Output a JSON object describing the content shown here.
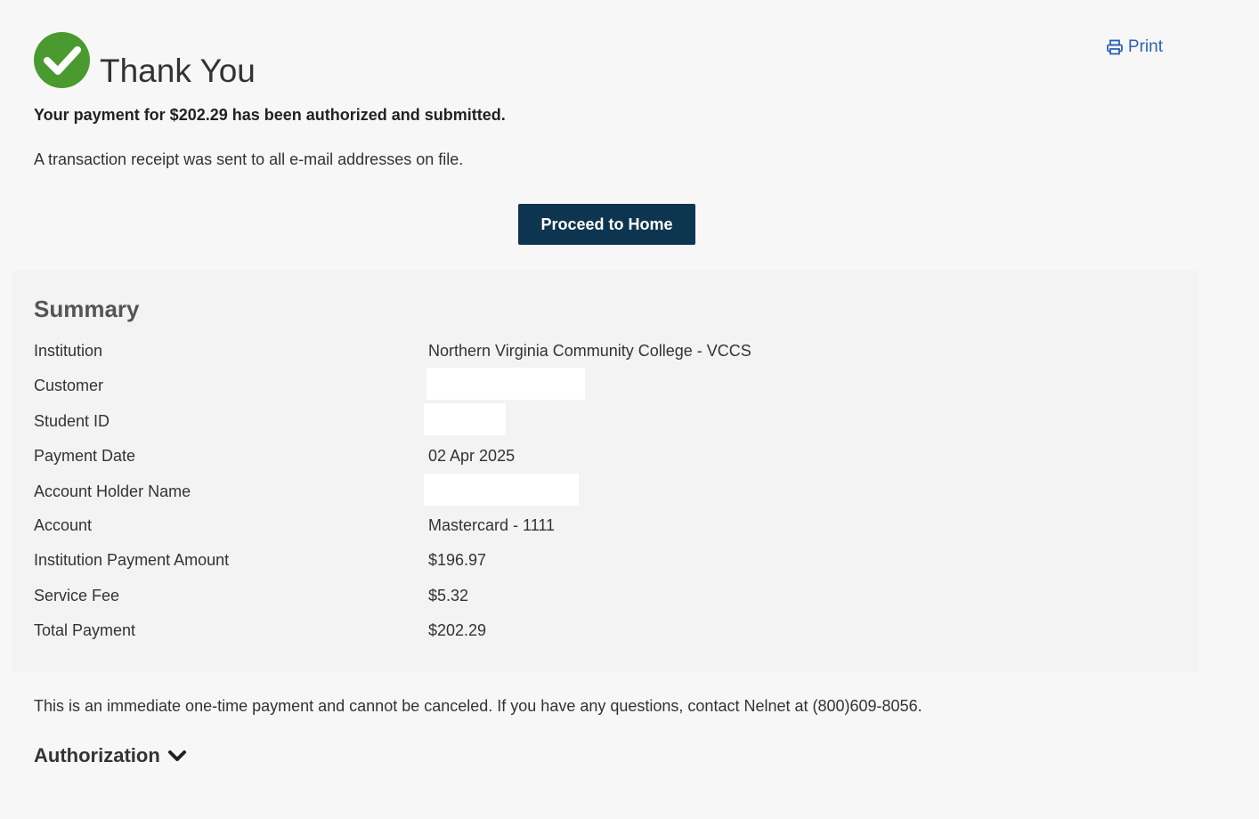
{
  "header": {
    "title": "Thank You",
    "print_label": "Print"
  },
  "messages": {
    "confirmation": "Your payment for $202.29 has been authorized and submitted.",
    "receipt": "A transaction receipt was sent to all e-mail addresses on file."
  },
  "actions": {
    "proceed_home_label": "Proceed to Home"
  },
  "summary": {
    "title": "Summary",
    "rows": [
      {
        "label": "Institution",
        "value": "Northern Virginia Community College - VCCS"
      },
      {
        "label": "Customer",
        "value": ""
      },
      {
        "label": "Student ID",
        "value": ""
      },
      {
        "label": "Payment Date",
        "value": "02 Apr 2025"
      },
      {
        "label": "Account Holder Name",
        "value": ""
      },
      {
        "label": "Account",
        "value": "Mastercard - 1111"
      },
      {
        "label": "Institution Payment Amount",
        "value": "$196.97"
      },
      {
        "label": "Service Fee",
        "value": "$5.32"
      },
      {
        "label": "Total Payment",
        "value": "$202.29"
      }
    ]
  },
  "disclaimer": "This is an immediate one-time payment and cannot be canceled. If you have any questions, contact Nelnet at (800)609-8056.",
  "authorization": {
    "label": "Authorization"
  },
  "icons": {
    "success": "check-circle-icon",
    "print": "printer-icon",
    "expand": "chevron-down-icon"
  },
  "colors": {
    "success_green": "#4a9a2f",
    "button_navy": "#0d3550",
    "link_blue": "#2a63b0"
  }
}
